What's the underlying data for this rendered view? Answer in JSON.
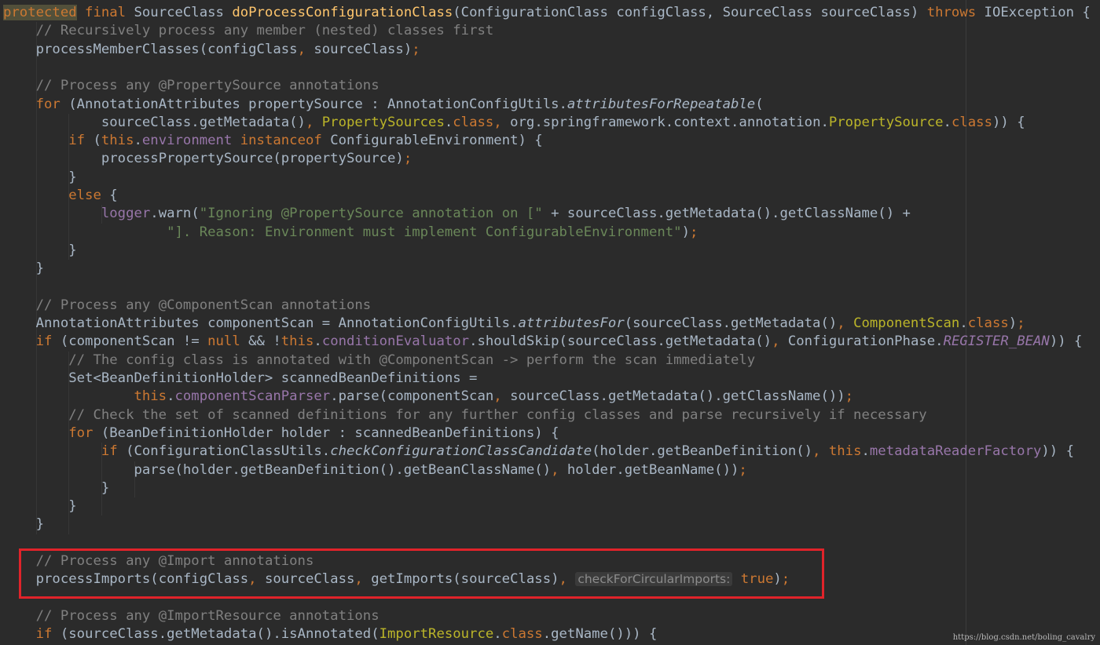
{
  "code_lines": [
    {
      "indent": 0,
      "tokens": [
        {
          "t": "protected",
          "s": "kw hl"
        },
        {
          "t": " ",
          "s": ""
        },
        {
          "t": "final",
          "s": "kw"
        },
        {
          "t": " SourceClass ",
          "s": ""
        },
        {
          "t": "doProcessConfigurationClass",
          "s": "fn"
        },
        {
          "t": "(ConfigurationClass configClass, SourceClass sourceClass) ",
          "s": ""
        },
        {
          "t": "throws",
          "s": "kw"
        },
        {
          "t": " IOException {",
          "s": ""
        }
      ]
    },
    {
      "indent": 1,
      "tokens": [
        {
          "t": "// Recursively process any member (nested) classes first",
          "s": "cm"
        }
      ]
    },
    {
      "indent": 1,
      "tokens": [
        {
          "t": "processMemberClasses(configClass",
          "s": ""
        },
        {
          "t": ", ",
          "s": "kw"
        },
        {
          "t": "sourceClass)",
          "s": ""
        },
        {
          "t": ";",
          "s": "kw"
        }
      ]
    },
    {
      "indent": 0,
      "tokens": []
    },
    {
      "indent": 1,
      "tokens": [
        {
          "t": "// Process any @PropertySource annotations",
          "s": "cm"
        }
      ]
    },
    {
      "indent": 1,
      "tokens": [
        {
          "t": "for",
          "s": "kw"
        },
        {
          "t": " (AnnotationAttributes propertySource : AnnotationConfigUtils.",
          "s": ""
        },
        {
          "t": "attributesForRepeatable",
          "s": "it"
        },
        {
          "t": "(",
          "s": ""
        }
      ]
    },
    {
      "indent": 3,
      "tokens": [
        {
          "t": "sourceClass.getMetadata()",
          "s": ""
        },
        {
          "t": ", ",
          "s": "kw"
        },
        {
          "t": "PropertySources",
          "s": "cl"
        },
        {
          "t": ".",
          "s": ""
        },
        {
          "t": "class",
          "s": "kw"
        },
        {
          "t": ", ",
          "s": "kw"
        },
        {
          "t": "org.springframework.context.annotation.",
          "s": ""
        },
        {
          "t": "PropertySource",
          "s": "cl"
        },
        {
          "t": ".",
          "s": ""
        },
        {
          "t": "class",
          "s": "kw"
        },
        {
          "t": ")) {",
          "s": ""
        }
      ]
    },
    {
      "indent": 2,
      "tokens": [
        {
          "t": "if",
          "s": "kw"
        },
        {
          "t": " (",
          "s": ""
        },
        {
          "t": "this",
          "s": "kw"
        },
        {
          "t": ".",
          "s": ""
        },
        {
          "t": "environment",
          "s": "fd"
        },
        {
          "t": " ",
          "s": ""
        },
        {
          "t": "instanceof",
          "s": "kw"
        },
        {
          "t": " ConfigurableEnvironment) {",
          "s": ""
        }
      ]
    },
    {
      "indent": 3,
      "tokens": [
        {
          "t": "processPropertySource(propertySource)",
          "s": ""
        },
        {
          "t": ";",
          "s": "kw"
        }
      ]
    },
    {
      "indent": 2,
      "tokens": [
        {
          "t": "}",
          "s": ""
        }
      ]
    },
    {
      "indent": 2,
      "tokens": [
        {
          "t": "else",
          "s": "kw"
        },
        {
          "t": " {",
          "s": ""
        }
      ]
    },
    {
      "indent": 3,
      "tokens": [
        {
          "t": "logger",
          "s": "fd"
        },
        {
          "t": ".warn(",
          "s": ""
        },
        {
          "t": "\"Ignoring @PropertySource annotation on [\"",
          "s": "st"
        },
        {
          "t": " + sourceClass.getMetadata().getClassName() +",
          "s": ""
        }
      ]
    },
    {
      "indent": 5,
      "tokens": [
        {
          "t": "\"]. Reason: Environment must implement ConfigurableEnvironment\"",
          "s": "st"
        },
        {
          "t": ")",
          "s": ""
        },
        {
          "t": ";",
          "s": "kw"
        }
      ]
    },
    {
      "indent": 2,
      "tokens": [
        {
          "t": "}",
          "s": ""
        }
      ]
    },
    {
      "indent": 1,
      "tokens": [
        {
          "t": "}",
          "s": ""
        }
      ]
    },
    {
      "indent": 0,
      "tokens": []
    },
    {
      "indent": 1,
      "tokens": [
        {
          "t": "// Process any @ComponentScan annotations",
          "s": "cm"
        }
      ]
    },
    {
      "indent": 1,
      "tokens": [
        {
          "t": "AnnotationAttributes componentScan = AnnotationConfigUtils.",
          "s": ""
        },
        {
          "t": "attributesFor",
          "s": "it"
        },
        {
          "t": "(sourceClass.getMetadata()",
          "s": ""
        },
        {
          "t": ", ",
          "s": "kw"
        },
        {
          "t": "ComponentScan",
          "s": "cl"
        },
        {
          "t": ".",
          "s": ""
        },
        {
          "t": "class",
          "s": "kw"
        },
        {
          "t": ")",
          "s": ""
        },
        {
          "t": ";",
          "s": "kw"
        }
      ]
    },
    {
      "indent": 1,
      "tokens": [
        {
          "t": "if",
          "s": "kw"
        },
        {
          "t": " (componentScan != ",
          "s": ""
        },
        {
          "t": "null",
          "s": "kw"
        },
        {
          "t": " && !",
          "s": ""
        },
        {
          "t": "this",
          "s": "kw"
        },
        {
          "t": ".",
          "s": ""
        },
        {
          "t": "conditionEvaluator",
          "s": "fd"
        },
        {
          "t": ".shouldSkip(sourceClass.getMetadata()",
          "s": ""
        },
        {
          "t": ", ",
          "s": "kw"
        },
        {
          "t": "ConfigurationPhase.",
          "s": ""
        },
        {
          "t": "REGISTER_BEAN",
          "s": "cf"
        },
        {
          "t": ")) {",
          "s": ""
        }
      ]
    },
    {
      "indent": 2,
      "tokens": [
        {
          "t": "// The config class is annotated with @ComponentScan -> perform the scan immediately",
          "s": "cm"
        }
      ]
    },
    {
      "indent": 2,
      "tokens": [
        {
          "t": "Set<BeanDefinitionHolder> scannedBeanDefinitions =",
          "s": ""
        }
      ]
    },
    {
      "indent": 4,
      "tokens": [
        {
          "t": "this",
          "s": "kw"
        },
        {
          "t": ".",
          "s": ""
        },
        {
          "t": "componentScanParser",
          "s": "fd"
        },
        {
          "t": ".parse(componentScan",
          "s": ""
        },
        {
          "t": ", ",
          "s": "kw"
        },
        {
          "t": "sourceClass.getMetadata().getClassName())",
          "s": ""
        },
        {
          "t": ";",
          "s": "kw"
        }
      ]
    },
    {
      "indent": 2,
      "tokens": [
        {
          "t": "// Check the set of scanned definitions for any further config classes and parse recursively if necessary",
          "s": "cm"
        }
      ]
    },
    {
      "indent": 2,
      "tokens": [
        {
          "t": "for",
          "s": "kw"
        },
        {
          "t": " (BeanDefinitionHolder holder : scannedBeanDefinitions) {",
          "s": ""
        }
      ]
    },
    {
      "indent": 3,
      "tokens": [
        {
          "t": "if",
          "s": "kw"
        },
        {
          "t": " (ConfigurationClassUtils.",
          "s": ""
        },
        {
          "t": "checkConfigurationClassCandidate",
          "s": "it"
        },
        {
          "t": "(holder.getBeanDefinition()",
          "s": ""
        },
        {
          "t": ", ",
          "s": "kw"
        },
        {
          "t": "this",
          "s": "kw"
        },
        {
          "t": ".",
          "s": ""
        },
        {
          "t": "metadataReaderFactory",
          "s": "fd"
        },
        {
          "t": ")) {",
          "s": ""
        }
      ]
    },
    {
      "indent": 4,
      "tokens": [
        {
          "t": "parse(holder.getBeanDefinition().getBeanClassName()",
          "s": ""
        },
        {
          "t": ", ",
          "s": "kw"
        },
        {
          "t": "holder.getBeanName())",
          "s": ""
        },
        {
          "t": ";",
          "s": "kw"
        }
      ]
    },
    {
      "indent": 3,
      "tokens": [
        {
          "t": "}",
          "s": ""
        }
      ]
    },
    {
      "indent": 2,
      "tokens": [
        {
          "t": "}",
          "s": ""
        }
      ]
    },
    {
      "indent": 1,
      "tokens": [
        {
          "t": "}",
          "s": ""
        }
      ]
    },
    {
      "indent": 0,
      "tokens": []
    },
    {
      "indent": 1,
      "tokens": [
        {
          "t": "// Process any @Import annotations",
          "s": "cm"
        }
      ]
    },
    {
      "indent": 1,
      "tokens": [
        {
          "t": "processImports(configClass",
          "s": ""
        },
        {
          "t": ", ",
          "s": "kw"
        },
        {
          "t": "sourceClass",
          "s": ""
        },
        {
          "t": ", ",
          "s": "kw"
        },
        {
          "t": "getImports(sourceClass)",
          "s": ""
        },
        {
          "t": ", ",
          "s": "kw"
        },
        {
          "t": "checkForCircularImports:",
          "s": "hint"
        },
        {
          "t": " ",
          "s": ""
        },
        {
          "t": "true",
          "s": "kw"
        },
        {
          "t": ")",
          "s": ""
        },
        {
          "t": ";",
          "s": "kw"
        }
      ]
    },
    {
      "indent": 0,
      "tokens": []
    },
    {
      "indent": 1,
      "tokens": [
        {
          "t": "// Process any @ImportResource annotations",
          "s": "cm"
        }
      ]
    },
    {
      "indent": 1,
      "tokens": [
        {
          "t": "if",
          "s": "kw"
        },
        {
          "t": " (sourceClass.getMetadata().isAnnotated(",
          "s": ""
        },
        {
          "t": "ImportResource",
          "s": "cl"
        },
        {
          "t": ".",
          "s": ""
        },
        {
          "t": "class",
          "s": "kw"
        },
        {
          "t": ".getName())) {",
          "s": ""
        }
      ]
    }
  ],
  "watermark": "https://blog.csdn.net/boling_cavalry",
  "colors": {
    "background": "#2b2b2b",
    "text": "#a9b7c6",
    "keyword": "#cc7832",
    "method_declaration": "#ffc66d",
    "comment": "#808080",
    "string": "#6a8759",
    "annotation_class": "#bbb529",
    "field": "#9876aa",
    "highlight_box": "#e0232a"
  }
}
